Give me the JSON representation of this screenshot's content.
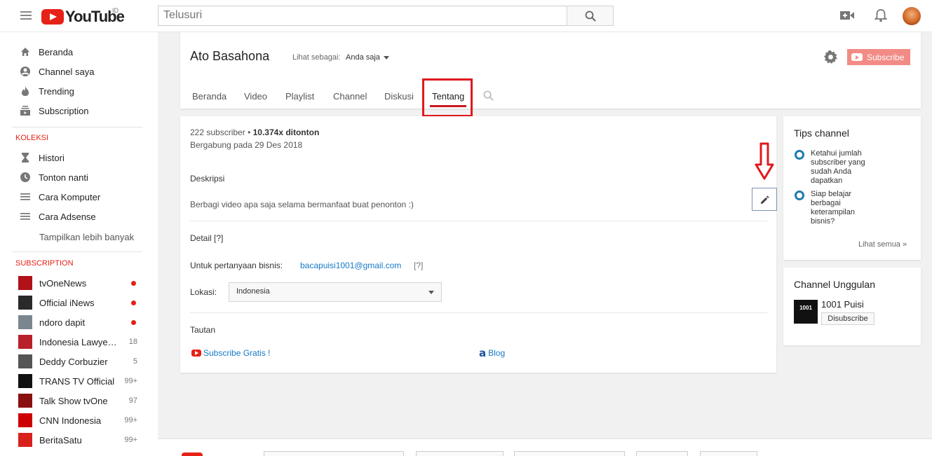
{
  "header": {
    "logo_text": "YouTube",
    "region": "ID",
    "search_placeholder": "Telusuri"
  },
  "sidebar": {
    "main_items": [
      {
        "label": "Beranda",
        "icon": "home-icon"
      },
      {
        "label": "Channel saya",
        "icon": "account-icon"
      },
      {
        "label": "Trending",
        "icon": "flame-icon"
      },
      {
        "label": "Subscription",
        "icon": "subscriptions-icon"
      }
    ],
    "collection_title": "KOLEKSI",
    "collection_items": [
      {
        "label": "Histori",
        "icon": "hourglass-icon"
      },
      {
        "label": "Tonton nanti",
        "icon": "clock-icon"
      },
      {
        "label": "Cara Komputer",
        "icon": "playlist-icon"
      },
      {
        "label": "Cara Adsense",
        "icon": "playlist-icon"
      }
    ],
    "show_more": "Tampilkan lebih banyak",
    "subscription_title": "SUBSCRIPTION",
    "subscriptions": [
      {
        "name": "tvOneNews",
        "count": "",
        "dot": true,
        "color": "#b01218"
      },
      {
        "name": "Official iNews",
        "count": "",
        "dot": true,
        "color": "#2a2a2a"
      },
      {
        "name": "ndoro dapit",
        "count": "",
        "dot": true,
        "color": "#7b8690"
      },
      {
        "name": "Indonesia Lawyer...",
        "count": "18",
        "dot": false,
        "color": "#b8202a"
      },
      {
        "name": "Deddy Corbuzier",
        "count": "5",
        "dot": false,
        "color": "#555555"
      },
      {
        "name": "TRANS TV Official",
        "count": "99+",
        "dot": false,
        "color": "#111111"
      },
      {
        "name": "Talk Show tvOne",
        "count": "97",
        "dot": false,
        "color": "#8a1010"
      },
      {
        "name": "CNN Indonesia",
        "count": "99+",
        "dot": false,
        "color": "#cc0000"
      },
      {
        "name": "BeritaSatu",
        "count": "99+",
        "dot": false,
        "color": "#d9211b"
      }
    ]
  },
  "channel": {
    "name": "Ato Basahona",
    "view_as_label": "Lihat sebagai:",
    "view_as_value": "Anda saja",
    "subscribe_label": "Subscribe",
    "tabs": [
      "Beranda",
      "Video",
      "Playlist",
      "Channel",
      "Diskusi",
      "Tentang"
    ],
    "active_tab": "Tentang"
  },
  "about": {
    "subscribers": "222 subscriber",
    "separator": "•",
    "views": "10.374x ditonton",
    "joined": "Bergabung pada 29 Des 2018",
    "description_heading": "Deskripsi",
    "description": "Berbagi video apa saja selama bermanfaat buat penonton :)",
    "details_heading": "Detail [?]",
    "business_label": "Untuk pertanyaan bisnis:",
    "business_email": "bacapuisi1001@gmail.com",
    "business_help": "[?]",
    "location_label": "Lokasi:",
    "location_value": "Indonesia",
    "links_heading": "Tautan",
    "links": [
      {
        "label": "Subscribe Gratis !",
        "icon": "youtube-icon"
      },
      {
        "label": "Blog",
        "icon": "blog-icon"
      }
    ]
  },
  "tips": {
    "title": "Tips channel",
    "items": [
      "Ketahui jumlah subscriber yang sudah Anda dapatkan",
      "Siap belajar berbagai keterampilan bisnis?"
    ],
    "see_all": "Lihat semua  »"
  },
  "featured": {
    "title": "Channel Unggulan",
    "channel_name": "1001 Puisi",
    "thumb_text": "1001",
    "unsubscribe_label": "Disubscribe"
  },
  "colors": {
    "brand_red": "#e62117",
    "link_blue": "#167ac6",
    "annotation_red": "#e0181e"
  }
}
